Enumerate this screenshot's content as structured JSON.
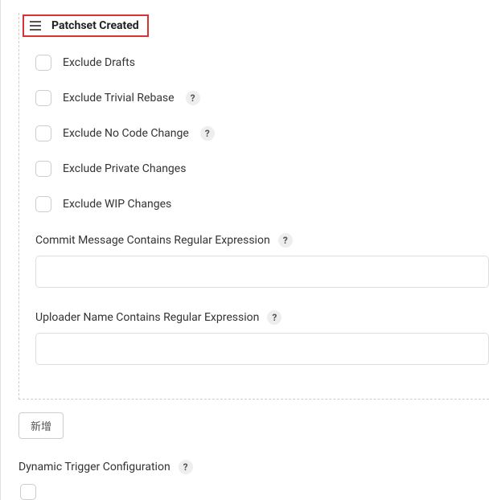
{
  "header": {
    "title": "Patchset Created"
  },
  "checkboxes": {
    "exclude_drafts": "Exclude Drafts",
    "exclude_trivial_rebase": "Exclude Trivial Rebase",
    "exclude_no_code_change": "Exclude No Code Change",
    "exclude_private_changes": "Exclude Private Changes",
    "exclude_wip_changes": "Exclude WIP Changes"
  },
  "fields": {
    "commit_message_regex": "Commit Message Contains Regular Expression",
    "uploader_name_regex": "Uploader Name Contains Regular Expression"
  },
  "buttons": {
    "add": "新增"
  },
  "bottom": {
    "dynamic_trigger_config": "Dynamic Trigger Configuration"
  },
  "help": "?"
}
